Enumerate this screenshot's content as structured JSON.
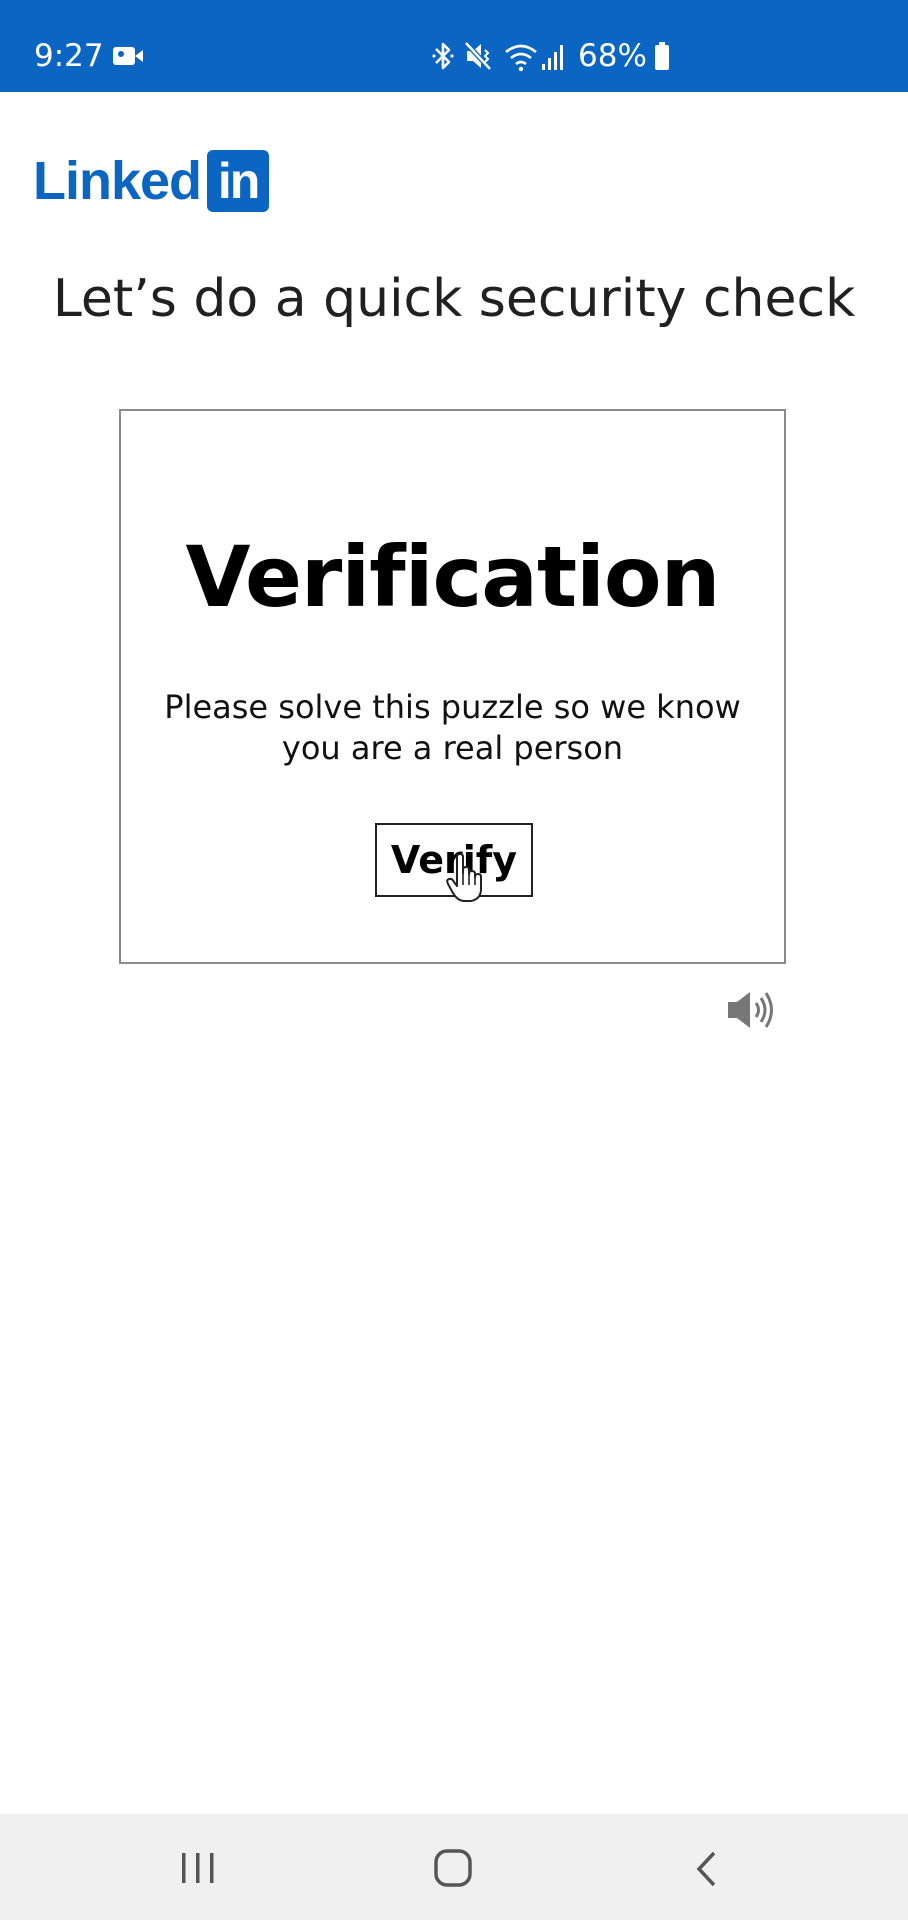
{
  "status_bar": {
    "time": "9:27",
    "battery": "68%",
    "background_color": "#0a66c2",
    "icons": [
      "video-camera-icon",
      "bluetooth-icon",
      "vibrate-mute-icon",
      "wifi-icon",
      "cell-signal-icon",
      "battery-icon"
    ]
  },
  "logo": {
    "word": "Linked",
    "box": "in",
    "color": "#0a66c2"
  },
  "page": {
    "title": "Let’s do a quick security check"
  },
  "challenge": {
    "heading": "Verification",
    "message": "Please solve this puzzle so we know you are a real person",
    "verify_label": "Verify",
    "audio_icon": "speaker-icon"
  },
  "nav_bar": {
    "icons": [
      "recent-apps-icon",
      "home-icon",
      "back-icon"
    ]
  }
}
